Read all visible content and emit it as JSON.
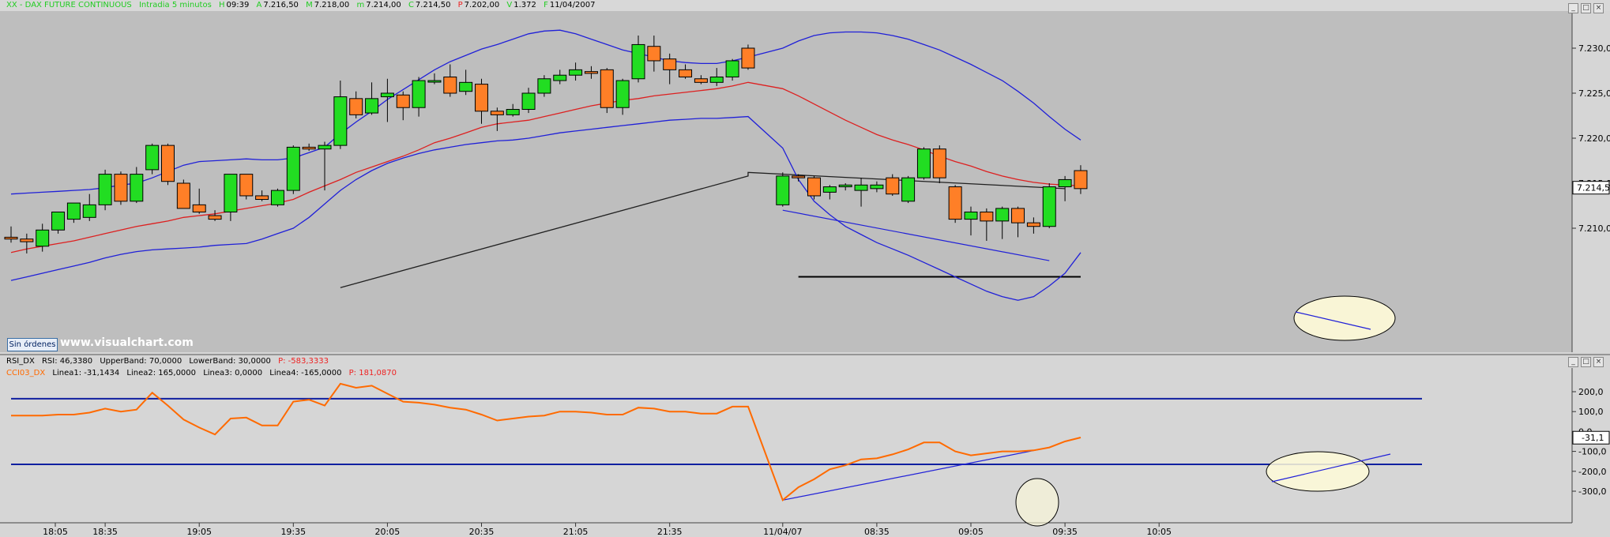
{
  "header": {
    "symbol": "XX - DAX FUTURE CONTINUOUS",
    "period": "Intradia 5 minutos",
    "time_label": "H",
    "time": "09:39",
    "open_label": "A",
    "open": "7.216,50",
    "high_label": "M",
    "high": "7.218,00",
    "low_label": "m",
    "low": "7.214,00",
    "close_label": "C",
    "close": "7.214,50",
    "prev_label": "P",
    "prev": "7.202,00",
    "vol_label": "V",
    "vol": "1.372",
    "date_label": "F",
    "date": "11/04/2007"
  },
  "orders_button": "Sin órdenes",
  "watermark": "www.visualchart.com",
  "rsi_header": {
    "name": "RSI_DX",
    "rsi": "RSI: 46,3380",
    "upper": "UpperBand: 70,0000",
    "lower": "LowerBand: 30,0000",
    "p": "P: -583,3333"
  },
  "cci_header": {
    "name": "CCI03_DX",
    "l1": "Linea1: -31,1434",
    "l2": "Linea2: 165,0000",
    "l3": "Linea3: 0,0000",
    "l4": "Linea4: -165,0000",
    "p": "P: 181,0870"
  },
  "colors": {
    "bg": "#bebebe",
    "panel": "#d6d6d6",
    "bull": "#22dd22",
    "bear": "#ff7f27",
    "bollinger": "#2020d8",
    "ma": "#dd2020",
    "long_ma": "#202020",
    "cci": "#ff6a00",
    "band": "#1020a0"
  },
  "chart_data": [
    {
      "type": "candlestick",
      "price_axis": {
        "ticks": [
          "7.230,0",
          "7.225,0",
          "7.220,0",
          "7.215,0",
          "7.210,0"
        ],
        "range": [
          7203.5,
          7232.3
        ],
        "last_price": "7.214,5",
        "last_value": 7214.5
      },
      "time_axis": {
        "labels": [
          "18:05",
          "18:35",
          "19:05",
          "19:35",
          "20:05",
          "20:35",
          "21:05",
          "21:35",
          "11/04/07",
          "08:35",
          "09:05",
          "09:35",
          "10:05"
        ]
      },
      "candles": [
        {
          "o": 7209.0,
          "h": 7210.2,
          "l": 7208.4,
          "c": 7208.8
        },
        {
          "o": 7208.8,
          "h": 7209.4,
          "l": 7207.2,
          "c": 7208.5
        },
        {
          "o": 7208.0,
          "h": 7210.5,
          "l": 7207.4,
          "c": 7209.8
        },
        {
          "o": 7209.8,
          "h": 7211.8,
          "l": 7209.4,
          "c": 7211.8
        },
        {
          "o": 7211.0,
          "h": 7212.8,
          "l": 7210.6,
          "c": 7212.8
        },
        {
          "o": 7211.2,
          "h": 7213.8,
          "l": 7210.8,
          "c": 7212.6
        },
        {
          "o": 7212.6,
          "h": 7216.5,
          "l": 7212.0,
          "c": 7216.0
        },
        {
          "o": 7216.0,
          "h": 7216.3,
          "l": 7212.6,
          "c": 7213.0
        },
        {
          "o": 7213.0,
          "h": 7216.8,
          "l": 7212.8,
          "c": 7216.0
        },
        {
          "o": 7216.5,
          "h": 7219.4,
          "l": 7216.0,
          "c": 7219.2
        },
        {
          "o": 7219.2,
          "h": 7219.4,
          "l": 7214.8,
          "c": 7215.2
        },
        {
          "o": 7215.0,
          "h": 7215.4,
          "l": 7212.4,
          "c": 7212.2
        },
        {
          "o": 7212.6,
          "h": 7214.4,
          "l": 7211.6,
          "c": 7211.8
        },
        {
          "o": 7211.4,
          "h": 7212.0,
          "l": 7210.8,
          "c": 7211.0
        },
        {
          "o": 7211.8,
          "h": 7216.0,
          "l": 7210.8,
          "c": 7216.0
        },
        {
          "o": 7216.0,
          "h": 7216.0,
          "l": 7213.2,
          "c": 7213.6
        },
        {
          "o": 7213.6,
          "h": 7214.2,
          "l": 7213.0,
          "c": 7213.2
        },
        {
          "o": 7212.6,
          "h": 7214.4,
          "l": 7212.4,
          "c": 7214.2
        },
        {
          "o": 7214.2,
          "h": 7219.2,
          "l": 7213.8,
          "c": 7219.0
        },
        {
          "o": 7219.0,
          "h": 7219.4,
          "l": 7218.6,
          "c": 7218.8
        },
        {
          "o": 7218.8,
          "h": 7219.6,
          "l": 7214.2,
          "c": 7219.2
        },
        {
          "o": 7219.2,
          "h": 7226.4,
          "l": 7218.8,
          "c": 7224.6
        },
        {
          "o": 7224.4,
          "h": 7225.2,
          "l": 7222.2,
          "c": 7222.6
        },
        {
          "o": 7222.8,
          "h": 7226.2,
          "l": 7222.6,
          "c": 7224.4
        },
        {
          "o": 7224.6,
          "h": 7226.6,
          "l": 7221.8,
          "c": 7225.0
        },
        {
          "o": 7224.8,
          "h": 7225.2,
          "l": 7222.0,
          "c": 7223.4
        },
        {
          "o": 7223.4,
          "h": 7226.8,
          "l": 7222.4,
          "c": 7226.4
        },
        {
          "o": 7226.4,
          "h": 7227.2,
          "l": 7226.0,
          "c": 7226.4
        },
        {
          "o": 7226.8,
          "h": 7228.2,
          "l": 7224.6,
          "c": 7225.0
        },
        {
          "o": 7225.2,
          "h": 7227.6,
          "l": 7224.8,
          "c": 7226.2
        },
        {
          "o": 7226.0,
          "h": 7226.6,
          "l": 7221.6,
          "c": 7223.0
        },
        {
          "o": 7223.0,
          "h": 7223.4,
          "l": 7220.8,
          "c": 7222.6
        },
        {
          "o": 7222.6,
          "h": 7223.8,
          "l": 7222.4,
          "c": 7223.2
        },
        {
          "o": 7223.2,
          "h": 7225.6,
          "l": 7222.8,
          "c": 7225.0
        },
        {
          "o": 7225.0,
          "h": 7227.0,
          "l": 7224.6,
          "c": 7226.6
        },
        {
          "o": 7226.4,
          "h": 7227.6,
          "l": 7226.0,
          "c": 7227.0
        },
        {
          "o": 7227.0,
          "h": 7228.4,
          "l": 7226.4,
          "c": 7227.6
        },
        {
          "o": 7227.4,
          "h": 7228.0,
          "l": 7226.6,
          "c": 7227.2
        },
        {
          "o": 7227.6,
          "h": 7227.8,
          "l": 7222.8,
          "c": 7223.4
        },
        {
          "o": 7223.4,
          "h": 7226.6,
          "l": 7222.6,
          "c": 7226.4
        },
        {
          "o": 7226.6,
          "h": 7231.4,
          "l": 7226.2,
          "c": 7230.4
        },
        {
          "o": 7230.2,
          "h": 7231.4,
          "l": 7227.4,
          "c": 7228.6
        },
        {
          "o": 7228.8,
          "h": 7229.4,
          "l": 7226.0,
          "c": 7227.6
        },
        {
          "o": 7227.6,
          "h": 7228.2,
          "l": 7226.6,
          "c": 7226.8
        },
        {
          "o": 7226.6,
          "h": 7227.0,
          "l": 7226.0,
          "c": 7226.2
        },
        {
          "o": 7226.2,
          "h": 7227.8,
          "l": 7225.8,
          "c": 7226.8
        },
        {
          "o": 7226.8,
          "h": 7228.8,
          "l": 7226.4,
          "c": 7228.6
        },
        {
          "o": 7230.0,
          "h": 7230.4,
          "l": 7227.6,
          "c": 7227.8
        },
        {
          "o": 7212.6,
          "h": 7216.2,
          "l": 7212.4,
          "c": 7215.8
        },
        {
          "o": 7215.8,
          "h": 7216.0,
          "l": 7215.2,
          "c": 7215.6
        },
        {
          "o": 7215.6,
          "h": 7215.8,
          "l": 7213.2,
          "c": 7213.6
        },
        {
          "o": 7214.0,
          "h": 7214.8,
          "l": 7213.2,
          "c": 7214.6
        },
        {
          "o": 7214.6,
          "h": 7215.0,
          "l": 7214.2,
          "c": 7214.8
        },
        {
          "o": 7214.2,
          "h": 7215.6,
          "l": 7212.4,
          "c": 7214.8
        },
        {
          "o": 7214.4,
          "h": 7215.2,
          "l": 7214.0,
          "c": 7214.8
        },
        {
          "o": 7215.6,
          "h": 7216.0,
          "l": 7213.6,
          "c": 7213.8
        },
        {
          "o": 7213.0,
          "h": 7215.8,
          "l": 7212.8,
          "c": 7215.6
        },
        {
          "o": 7215.6,
          "h": 7219.0,
          "l": 7215.4,
          "c": 7218.8
        },
        {
          "o": 7218.8,
          "h": 7219.2,
          "l": 7215.0,
          "c": 7215.6
        },
        {
          "o": 7214.6,
          "h": 7214.8,
          "l": 7210.6,
          "c": 7211.0
        },
        {
          "o": 7211.0,
          "h": 7212.4,
          "l": 7209.2,
          "c": 7211.8
        },
        {
          "o": 7211.8,
          "h": 7212.2,
          "l": 7208.6,
          "c": 7210.8
        },
        {
          "o": 7210.8,
          "h": 7212.4,
          "l": 7208.8,
          "c": 7212.2
        },
        {
          "o": 7212.2,
          "h": 7212.4,
          "l": 7209.0,
          "c": 7210.6
        },
        {
          "o": 7210.6,
          "h": 7211.2,
          "l": 7209.4,
          "c": 7210.2
        },
        {
          "o": 7210.2,
          "h": 7215.0,
          "l": 7210.0,
          "c": 7214.6
        },
        {
          "o": 7214.6,
          "h": 7215.8,
          "l": 7213.0,
          "c": 7215.4
        },
        {
          "o": 7216.4,
          "h": 7217.0,
          "l": 7213.8,
          "c": 7214.4
        }
      ],
      "bollinger_upper": [
        7213.8,
        7213.9,
        7214.0,
        7214.1,
        7214.2,
        7214.3,
        7214.5,
        7214.8,
        7215.0,
        7215.6,
        7216.3,
        7217.0,
        7217.4,
        7217.5,
        7217.6,
        7217.7,
        7217.6,
        7217.6,
        7217.8,
        7218.4,
        7219.0,
        7220.5,
        7221.8,
        7223.0,
        7224.3,
        7225.4,
        7226.5,
        7227.6,
        7228.5,
        7229.2,
        7229.9,
        7230.4,
        7231.0,
        7231.6,
        7231.9,
        7232.0,
        7231.6,
        7231.0,
        7230.4,
        7229.8,
        7229.4,
        7229.0,
        7228.6,
        7228.4,
        7228.3,
        7228.3,
        7228.6,
        7229.0,
        7230.0,
        7230.8,
        7231.4,
        7231.7,
        7231.8,
        7231.8,
        7231.7,
        7231.4,
        7231.0,
        7230.4,
        7229.8,
        7229.0,
        7228.2,
        7227.3,
        7226.4,
        7225.2,
        7223.9,
        7222.4,
        7221.0,
        7219.8
      ],
      "bollinger_lower": [
        7204.2,
        7204.6,
        7205.0,
        7205.4,
        7205.8,
        7206.2,
        7206.7,
        7207.1,
        7207.4,
        7207.6,
        7207.7,
        7207.8,
        7207.9,
        7208.1,
        7208.2,
        7208.3,
        7208.8,
        7209.4,
        7210.0,
        7211.2,
        7212.7,
        7214.2,
        7215.4,
        7216.4,
        7217.2,
        7217.8,
        7218.3,
        7218.7,
        7219.0,
        7219.3,
        7219.5,
        7219.7,
        7219.8,
        7220.0,
        7220.3,
        7220.6,
        7220.8,
        7221.0,
        7221.2,
        7221.4,
        7221.6,
        7221.8,
        7222.0,
        7222.1,
        7222.2,
        7222.2,
        7222.3,
        7222.4,
        7218.9,
        7215.4,
        7213.0,
        7211.5,
        7210.2,
        7209.3,
        7208.4,
        7207.7,
        7207.0,
        7206.2,
        7205.4,
        7204.6,
        7203.8,
        7203.0,
        7202.4,
        7202.0,
        7202.4,
        7203.6,
        7205.0,
        7207.3
      ],
      "ma_20": [
        7207.3,
        7207.7,
        7208.0,
        7208.3,
        7208.6,
        7209.0,
        7209.4,
        7209.8,
        7210.2,
        7210.5,
        7210.8,
        7211.2,
        7211.4,
        7211.6,
        7211.9,
        7212.2,
        7212.5,
        7212.8,
        7213.2,
        7214.0,
        7214.7,
        7215.4,
        7216.2,
        7216.8,
        7217.4,
        7218.0,
        7218.7,
        7219.5,
        7220.0,
        7220.6,
        7221.2,
        7221.6,
        7221.8,
        7222.0,
        7222.4,
        7222.8,
        7223.2,
        7223.6,
        7223.9,
        7224.2,
        7224.4,
        7224.7,
        7224.9,
        7225.1,
        7225.3,
        7225.5,
        7225.8,
        7226.2,
        7225.5,
        7224.7,
        7223.8,
        7222.9,
        7222.0,
        7221.2,
        7220.4,
        7219.8,
        7219.3,
        7218.7,
        7218.0,
        7217.4,
        7216.9,
        7216.3,
        7215.8,
        7215.4,
        7215.1,
        7214.9,
        7214.8,
        7214.7
      ],
      "ma_long": {
        "start_value": 7203.4,
        "end_value": 7215.8,
        "after_gap_start": 7216.2,
        "after_gap_end": 7214.4
      },
      "support_line": 7204.6
    },
    {
      "type": "line",
      "name": "CCI03_DX",
      "y_ticks": [
        "200,0",
        "100,0",
        "0,0",
        "-100,0",
        "-200,0",
        "-300,0"
      ],
      "range": [
        -380,
        240
      ],
      "last_value": "-31,1",
      "bands": [
        165,
        -165
      ],
      "values": [
        80,
        80,
        80,
        85,
        85,
        95,
        115,
        100,
        110,
        195,
        130,
        60,
        20,
        -15,
        65,
        70,
        30,
        30,
        150,
        160,
        130,
        240,
        220,
        230,
        190,
        150,
        145,
        135,
        120,
        110,
        85,
        55,
        65,
        75,
        80,
        100,
        100,
        95,
        85,
        85,
        120,
        115,
        100,
        100,
        90,
        90,
        125,
        125,
        -345,
        -280,
        -240,
        -190,
        -170,
        -140,
        -135,
        -115,
        -90,
        -55,
        -55,
        -100,
        -120,
        -110,
        -100,
        -100,
        -95,
        -80,
        -50,
        -30
      ],
      "trend_from": -345,
      "trend_to": -80
    }
  ]
}
